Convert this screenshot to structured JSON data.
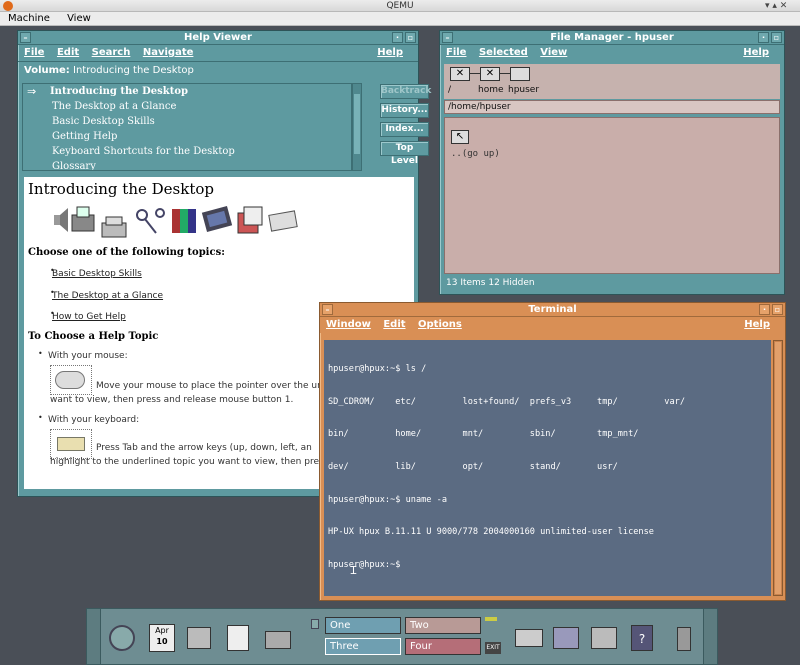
{
  "qemu": {
    "title": "QEMU",
    "menu": [
      "Machine",
      "View"
    ]
  },
  "help_viewer": {
    "title": "Help Viewer",
    "menu": [
      "File",
      "Edit",
      "Search",
      "Navigate"
    ],
    "help": "Help",
    "volume_label": "Volume:",
    "volume_value": "Introducing the Desktop",
    "arrow": "⇒",
    "topics": [
      "Introducing the Desktop",
      "The Desktop at a Glance",
      "Basic Desktop Skills",
      "Getting Help",
      "Keyboard Shortcuts for the Desktop",
      "Glossary"
    ],
    "buttons": [
      "Backtrack",
      "History...",
      "Index...",
      "Top Level"
    ],
    "doc": {
      "heading": "Introducing the Desktop",
      "choose": "Choose one of the following topics:",
      "links": [
        "Basic Desktop Skills",
        "The Desktop at a Glance",
        "How to Get Help"
      ],
      "subheading": "To Choose a Help Topic",
      "mouse_label": "With your mouse:",
      "mouse_text1": "Move your mouse to place the pointer over the un",
      "mouse_text2": "want to view, then press and release mouse button 1.",
      "kbd_label": "With your keyboard:",
      "kbd_text1": "Press Tab and the arrow keys (up, down, left, an",
      "kbd_text2": "highlight to the underlined topic you want to view, then press"
    }
  },
  "file_manager": {
    "title": "File Manager - hpuser",
    "menu": [
      "File",
      "Selected",
      "View"
    ],
    "help": "Help",
    "path_labels": [
      "/",
      "home",
      "hpuser"
    ],
    "path": "/home/hpuser",
    "go_up": "..(go up)",
    "status": "13 Items 12 Hidden"
  },
  "terminal": {
    "title": "Terminal",
    "menu": [
      "Window",
      "Edit",
      "Options"
    ],
    "help": "Help",
    "lines": [
      "hpuser@hpux:~$ ls /",
      "SD_CDROM/    etc/         lost+found/  prefs_v3     tmp/         var/",
      "bin/         home/        mnt/         sbin/        tmp_mnt/",
      "dev/         lib/         opt/         stand/       usr/",
      "hpuser@hpux:~$ uname -a",
      "HP-UX hpux B.11.11 U 9000/778 2004000160 unlimited-user license",
      "hpuser@hpux:~$"
    ]
  },
  "front_panel": {
    "calendar_month": "Apr",
    "calendar_day": "10",
    "workspaces": [
      {
        "label": "One",
        "color": "#6f9fb1"
      },
      {
        "label": "Two",
        "color": "#b89a96"
      },
      {
        "label": "Three",
        "color": "#6f9fb1"
      },
      {
        "label": "Four",
        "color": "#b56e78"
      }
    ],
    "exit": "EXIT"
  }
}
